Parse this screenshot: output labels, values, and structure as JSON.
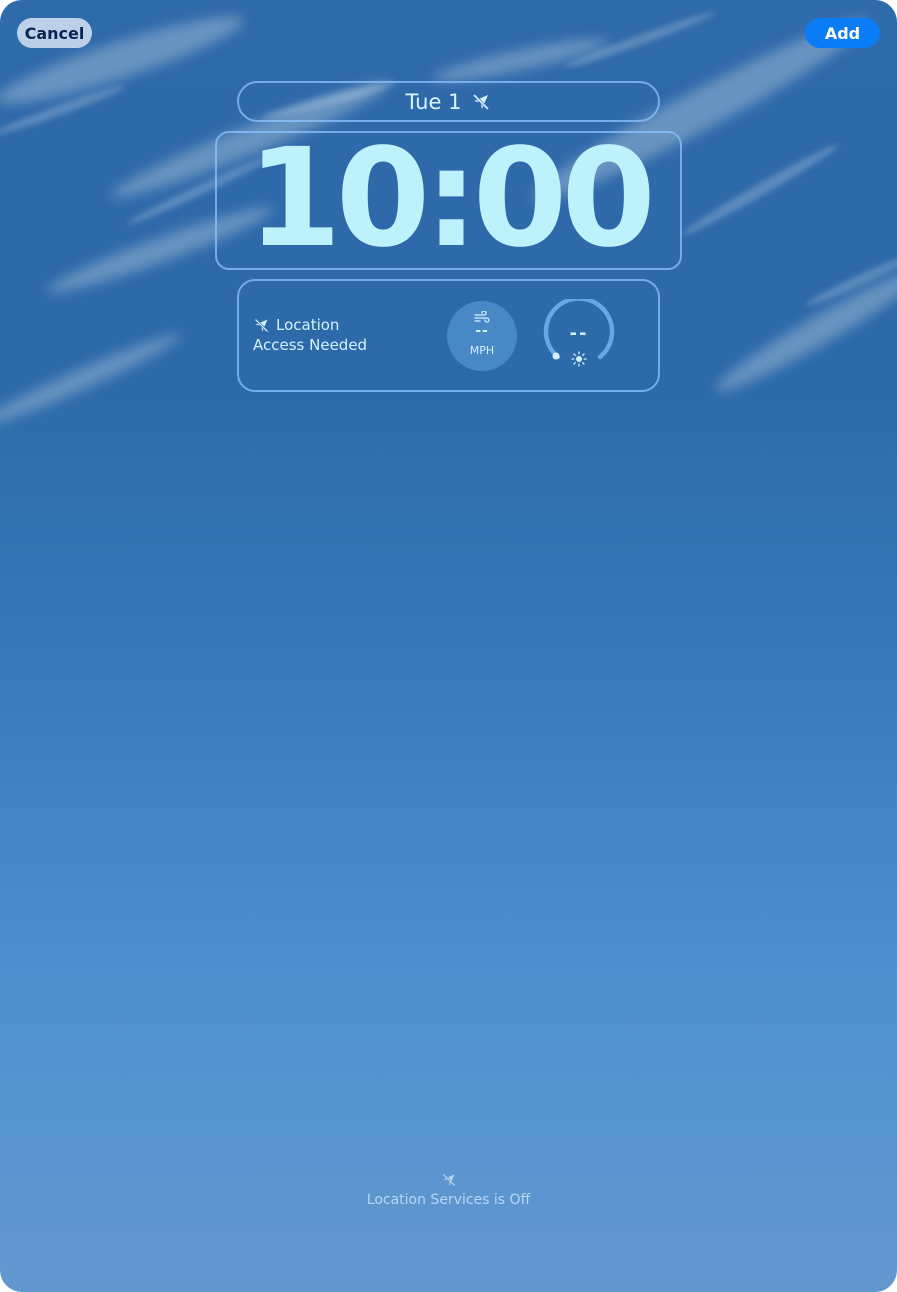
{
  "toolbar": {
    "cancel_label": "Cancel",
    "add_label": "Add"
  },
  "lock_screen": {
    "date": "Tue 1",
    "time": "10:00"
  },
  "widgets": {
    "location_line1": "Location",
    "location_line2": "Access Needed",
    "wind_value": "--",
    "wind_unit": "MPH",
    "gauge_value": "--"
  },
  "footer": {
    "status_text": "Location Services is Off"
  },
  "icons": {
    "date": "location-slash-icon",
    "location": "location-slash-icon",
    "wind": "wind-icon",
    "gauge": "sun-icon",
    "footer": "location-slash-icon"
  },
  "colors": {
    "add_button": "#0a7cf5",
    "time_text": "#bdf1fb",
    "frame_outline": "#8cc3ff"
  }
}
